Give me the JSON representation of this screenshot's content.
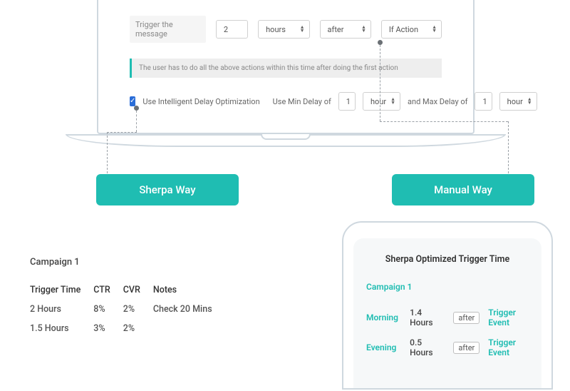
{
  "laptop": {
    "trigger_label": "Trigger the message",
    "count": "2",
    "unit": "hours",
    "when": "after",
    "condition": "If Action",
    "banner": "The user has to do all the above actions within this time after doing the first action",
    "chk_label": "Use Intelligent Delay Optimization",
    "min_label": "Use Min Delay of",
    "min_val": "1",
    "min_unit": "hour",
    "join": "and Max Delay of",
    "max_val": "1",
    "max_unit": "hour"
  },
  "buttons": {
    "sherpa": "Sherpa Way",
    "manual": "Manual Way"
  },
  "phone": {
    "title": "Sherpa Optimized Trigger Time",
    "campaign": "Campaign 1",
    "rows": [
      {
        "period": "Morning",
        "hours": "1.4 Hours",
        "tag": "after",
        "event": "Trigger Event"
      },
      {
        "period": "Evening",
        "hours": "0.5 Hours",
        "tag": "after",
        "event": "Trigger Event"
      }
    ]
  },
  "table": {
    "title": "Campaign 1",
    "headers": [
      "Trigger Time",
      "CTR",
      "CVR",
      "Notes"
    ],
    "rows": [
      [
        "2 Hours",
        "8%",
        "2%",
        "Check 20 Mins"
      ],
      [
        "1.5 Hours",
        "3%",
        "2%",
        ""
      ]
    ]
  }
}
